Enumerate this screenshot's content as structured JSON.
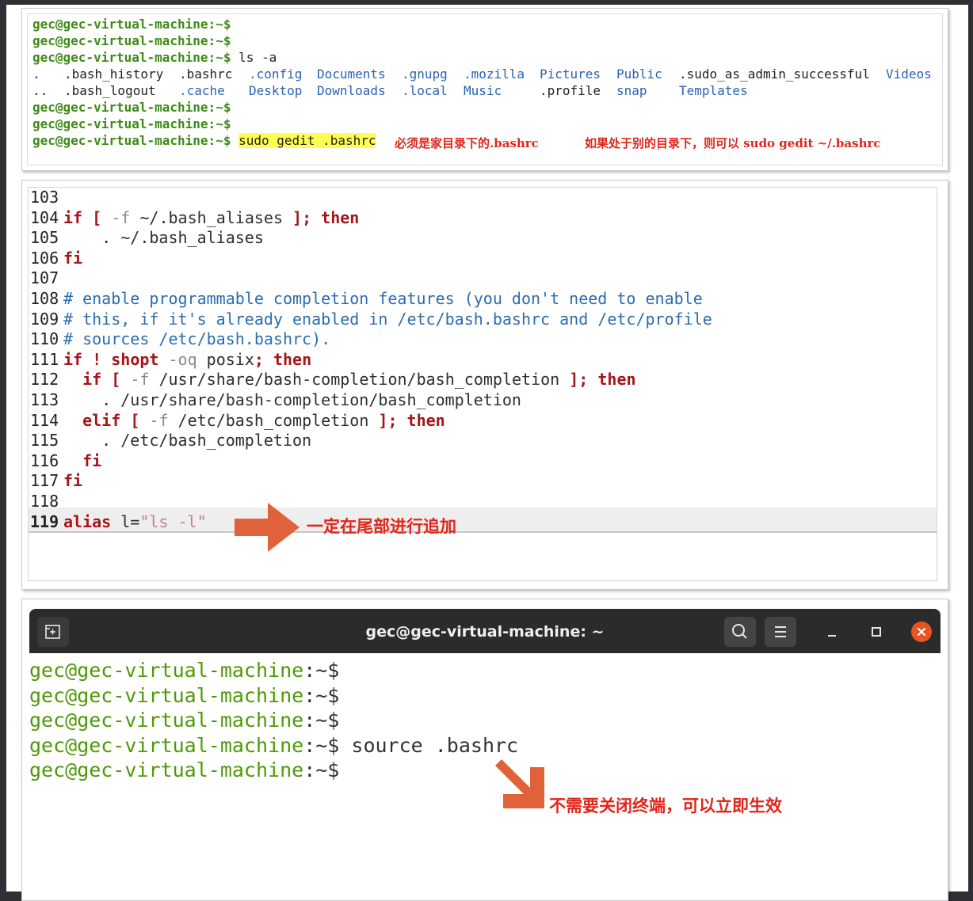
{
  "top_terminal": {
    "prompt": "gec@gec-virtual-machine:~$",
    "cmd_ls": " ls -a",
    "ls_row1": [
      ".",
      ".bash_history",
      ".bashrc",
      ".config",
      "Documents",
      ".gnupg",
      ".mozilla",
      "Pictures",
      "Public",
      ".sudo_as_admin_successful",
      "Videos"
    ],
    "ls_row2": [
      "..",
      ".bash_logout",
      ".cache",
      "Desktop",
      "Downloads",
      ".local",
      "Music",
      ".profile",
      "snap",
      "Templates"
    ],
    "cmd_gedit": "sudo gedit .bashrc",
    "note1": "必须是家目录下的.bashrc",
    "note2": "如果处于别的目录下，则可以 sudo gedit ~/.bashrc"
  },
  "editor": {
    "lines": [
      {
        "n": "103",
        "t": ""
      },
      {
        "n": "104",
        "t": "if [ -f ~/.bash_aliases ]; then"
      },
      {
        "n": "105",
        "t": "    . ~/.bash_aliases"
      },
      {
        "n": "106",
        "t": "fi"
      },
      {
        "n": "107",
        "t": ""
      },
      {
        "n": "108",
        "t": "# enable programmable completion features (you don't need to enable"
      },
      {
        "n": "109",
        "t": "# this, if it's already enabled in /etc/bash.bashrc and /etc/profile"
      },
      {
        "n": "110",
        "t": "# sources /etc/bash.bashrc)."
      },
      {
        "n": "111",
        "t": "if ! shopt -oq posix; then"
      },
      {
        "n": "112",
        "t": "  if [ -f /usr/share/bash-completion/bash_completion ]; then"
      },
      {
        "n": "113",
        "t": "    . /usr/share/bash-completion/bash_completion"
      },
      {
        "n": "114",
        "t": "  elif [ -f /etc/bash_completion ]; then"
      },
      {
        "n": "115",
        "t": "    . /etc/bash_completion"
      },
      {
        "n": "116",
        "t": "  fi"
      },
      {
        "n": "117",
        "t": "fi"
      },
      {
        "n": "118",
        "t": ""
      },
      {
        "n": "119",
        "t": "alias l=\"ls -l\""
      }
    ],
    "annotation": "一定在尾部进行追加"
  },
  "bottom_terminal": {
    "title": "gec@gec-virtual-machine: ~",
    "prompt_user": "gec@gec-virtual-machine",
    "prompt_tail": ":~$",
    "command": " source .bashrc",
    "annotation": "不需要关闭终端，可以立即生效"
  },
  "colors": {
    "prompt_green": "#3d8a16",
    "dir_blue": "#2a62b5",
    "keyword_red": "#a4161a",
    "note_red": "#e0261b",
    "arrow_orange": "#e0623a"
  }
}
